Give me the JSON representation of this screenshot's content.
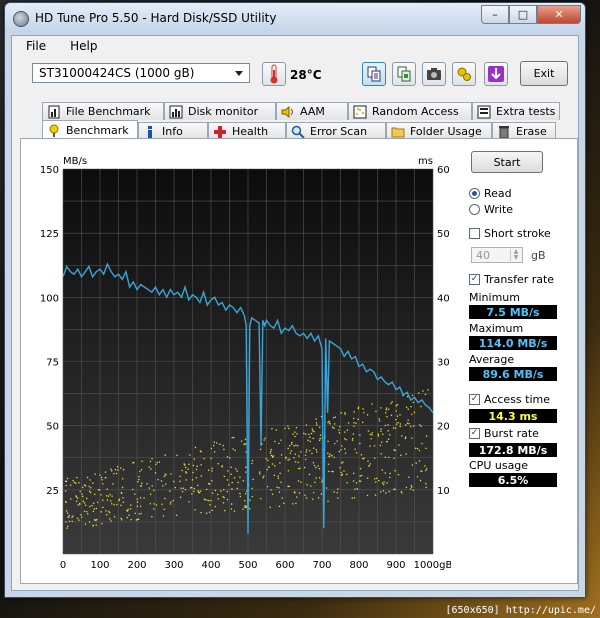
{
  "window": {
    "title": "HD Tune Pro 5.50 - Hard Disk/SSD Utility",
    "minimize_glyph": "–",
    "maximize_glyph": "□",
    "close_glyph": "✕"
  },
  "menu": [
    {
      "label": "File"
    },
    {
      "label": "Help"
    }
  ],
  "toolbar": {
    "drive": "ST31000424CS (1000 gB)",
    "temperature": "28°C",
    "exit_label": "Exit",
    "icons": [
      "copy-text-icon",
      "copy-screenshot-icon",
      "camera-icon",
      "options-icon",
      "save-icon"
    ]
  },
  "tabs_top": [
    {
      "label": "File Benchmark",
      "icon": "file-benchmark-icon"
    },
    {
      "label": "Disk monitor",
      "icon": "disk-monitor-icon"
    },
    {
      "label": "AAM",
      "icon": "speaker-icon"
    },
    {
      "label": "Random Access",
      "icon": "random-access-icon"
    },
    {
      "label": "Extra tests",
      "icon": "extra-tests-icon"
    }
  ],
  "tabs_bottom": [
    {
      "label": "Benchmark",
      "icon": "benchmark-icon",
      "selected": true
    },
    {
      "label": "Info",
      "icon": "info-icon"
    },
    {
      "label": "Health",
      "icon": "health-icon"
    },
    {
      "label": "Error Scan",
      "icon": "error-scan-icon"
    },
    {
      "label": "Folder Usage",
      "icon": "folder-icon"
    },
    {
      "label": "Erase",
      "icon": "trash-icon"
    }
  ],
  "controls": {
    "start_label": "Start",
    "read_label": "Read",
    "write_label": "Write",
    "mode": "Read",
    "short_stroke_label": "Short stroke",
    "short_stroke_checked": false,
    "short_stroke_value": "40",
    "short_stroke_unit": "gB",
    "transfer_rate_label": "Transfer rate",
    "transfer_rate_checked": true,
    "minimum_label": "Minimum",
    "minimum_value": "7.5 MB/s",
    "maximum_label": "Maximum",
    "maximum_value": "114.0 MB/s",
    "average_label": "Average",
    "average_value": "89.6 MB/s",
    "access_time_label": "Access time",
    "access_time_checked": true,
    "access_time_value": "14.3 ms",
    "burst_rate_label": "Burst rate",
    "burst_rate_checked": true,
    "burst_rate_value": "172.8 MB/s",
    "cpu_usage_label": "CPU usage",
    "cpu_usage_value": "6.5%"
  },
  "colors": {
    "transfer_line": "#3aa6d8",
    "access_points": "#e8e030",
    "value_blue": "#4fc3f7",
    "value_yellow": "#ffff40",
    "value_white": "#ffffff",
    "chart_bg_top": "#0c0c0c",
    "chart_bg_bottom": "#3a3a3a"
  },
  "chart_data": {
    "type": "line",
    "ylabel_left": "MB/s",
    "ylabel_right": "ms",
    "xunit": "gB",
    "ylim_left": [
      0,
      150
    ],
    "ylim_right": [
      0,
      60
    ],
    "xlim": [
      0,
      1000
    ],
    "left_ticks": [
      25,
      50,
      75,
      100,
      125,
      150
    ],
    "right_ticks": [
      10,
      20,
      30,
      40,
      50,
      60
    ],
    "x_ticks": [
      0,
      100,
      200,
      300,
      400,
      500,
      600,
      700,
      800,
      900,
      1000
    ],
    "grid": true,
    "series": [
      {
        "kind": "transfer-rate",
        "x": [
          0,
          10,
          20,
          30,
          40,
          50,
          60,
          70,
          80,
          90,
          100,
          110,
          120,
          130,
          140,
          150,
          160,
          170,
          180,
          190,
          200,
          210,
          220,
          230,
          240,
          250,
          260,
          270,
          280,
          290,
          300,
          310,
          320,
          330,
          340,
          350,
          360,
          370,
          380,
          390,
          400,
          410,
          420,
          430,
          440,
          450,
          460,
          470,
          480,
          490,
          495,
          500,
          505,
          510,
          520,
          530,
          535,
          540,
          545,
          550,
          560,
          570,
          580,
          590,
          600,
          610,
          620,
          630,
          640,
          650,
          660,
          670,
          680,
          690,
          700,
          705,
          710,
          715,
          720,
          730,
          740,
          750,
          760,
          770,
          780,
          790,
          800,
          810,
          820,
          830,
          840,
          850,
          860,
          870,
          880,
          890,
          900,
          910,
          920,
          930,
          940,
          950,
          960,
          970,
          980,
          990,
          1000
        ],
        "y": [
          108,
          112,
          110,
          109,
          111,
          108,
          110,
          112,
          108,
          110,
          111,
          109,
          113,
          110,
          108,
          109,
          107,
          110,
          104,
          106,
          103,
          105,
          104,
          103,
          102,
          104,
          101,
          103,
          100,
          103,
          101,
          102,
          100,
          104,
          99,
          101,
          100,
          98,
          102,
          97,
          99,
          100,
          97,
          98,
          95,
          97,
          96,
          94,
          96,
          93,
          89,
          8,
          89,
          92,
          91,
          90,
          42,
          91,
          89,
          91,
          89,
          88,
          91,
          86,
          88,
          87,
          89,
          86,
          85,
          86,
          84,
          86,
          83,
          85,
          80,
          10,
          84,
          55,
          83,
          82,
          81,
          80,
          77,
          79,
          76,
          77,
          73,
          74,
          71,
          72,
          71,
          68,
          69,
          67,
          66,
          67,
          64,
          65,
          62,
          63,
          60,
          61,
          59,
          60,
          58,
          57,
          55
        ]
      },
      {
        "kind": "access-time-scatter",
        "description_from_image": false,
        "ms_min": 4,
        "ms_max": 24
      }
    ]
  },
  "watermark": "[650x650] http://upic.me/"
}
